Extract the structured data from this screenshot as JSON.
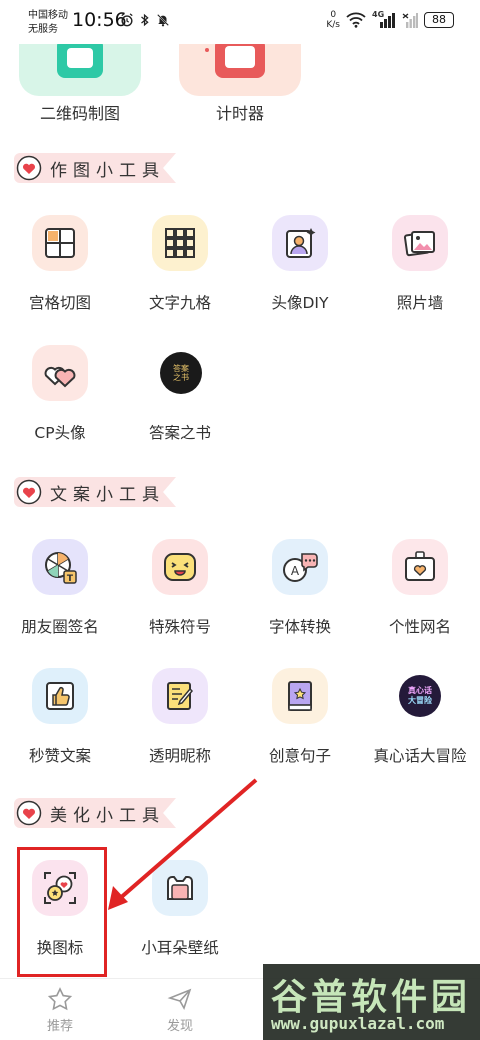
{
  "status_bar": {
    "carrier_line1": "中国移动",
    "carrier_line2": "无服务",
    "time": "10:56",
    "net_speed_value": "0",
    "net_speed_unit": "K/s",
    "network_type": "4G",
    "battery": "88"
  },
  "top_tools": [
    {
      "label": "二维码制图",
      "icon": "qr-code-icon",
      "color": "#d8f5e8"
    },
    {
      "label": "计时器",
      "icon": "timer-icon",
      "color": "#fde5dc"
    }
  ],
  "sections": {
    "drawing": {
      "title": "作图小工具"
    },
    "copywriting": {
      "title": "文案小工具"
    },
    "beautify": {
      "title": "美化小工具"
    }
  },
  "drawing_tools": [
    {
      "label": "宫格切图",
      "icon": "grid-cut-icon",
      "color": "#fde8df"
    },
    {
      "label": "文字九格",
      "icon": "text-grid-icon",
      "color": "#fdf1cf"
    },
    {
      "label": "头像DIY",
      "icon": "avatar-diy-icon",
      "color": "#ece6fb"
    },
    {
      "label": "照片墙",
      "icon": "photo-wall-icon",
      "color": "#fbe3ec"
    },
    {
      "label": "CP头像",
      "icon": "cp-avatar-icon",
      "color": "#fde7e3"
    },
    {
      "label": "答案之书",
      "icon": "answer-book-icon",
      "color": "#1a1a1a"
    }
  ],
  "copy_tools": [
    {
      "label": "朋友圈签名",
      "icon": "moments-signature-icon",
      "color": "#e5e3fb"
    },
    {
      "label": "特殊符号",
      "icon": "special-symbol-icon",
      "color": "#fde3e3"
    },
    {
      "label": "字体转换",
      "icon": "font-convert-icon",
      "color": "#e3f0fb"
    },
    {
      "label": "个性网名",
      "icon": "nickname-icon",
      "color": "#fde7ea"
    },
    {
      "label": "秒赞文案",
      "icon": "like-copy-icon",
      "color": "#dff0fb"
    },
    {
      "label": "透明昵称",
      "icon": "transparent-nickname-icon",
      "color": "#efe6fb"
    },
    {
      "label": "创意句子",
      "icon": "creative-sentence-icon",
      "color": "#fdf1df"
    },
    {
      "label": "真心话大冒险",
      "icon": "truth-or-dare-icon",
      "color": "#241a3a"
    }
  ],
  "beautify_tools": [
    {
      "label": "换图标",
      "icon": "change-icon-icon",
      "color": "#fbe3ee"
    },
    {
      "label": "小耳朵壁纸",
      "icon": "ear-wallpaper-icon",
      "color": "#e3f1fb"
    }
  ],
  "answer_book_badge": "答案之书",
  "truth_dare_badge_line1": "真心话",
  "truth_dare_badge_line2": "大冒险",
  "bottom_nav": [
    {
      "label": "推荐",
      "icon": "star-icon"
    },
    {
      "label": "发现",
      "icon": "send-icon"
    }
  ],
  "watermark": {
    "title": "谷普软件园",
    "url": "www.gupuxlazal.com"
  },
  "colors": {
    "accent_red": "#e02424",
    "ribbon_pink": "#fbe3e3",
    "heart_red": "#e8434b",
    "label_gray": "#333333",
    "nav_gray": "#9a9a9a"
  }
}
